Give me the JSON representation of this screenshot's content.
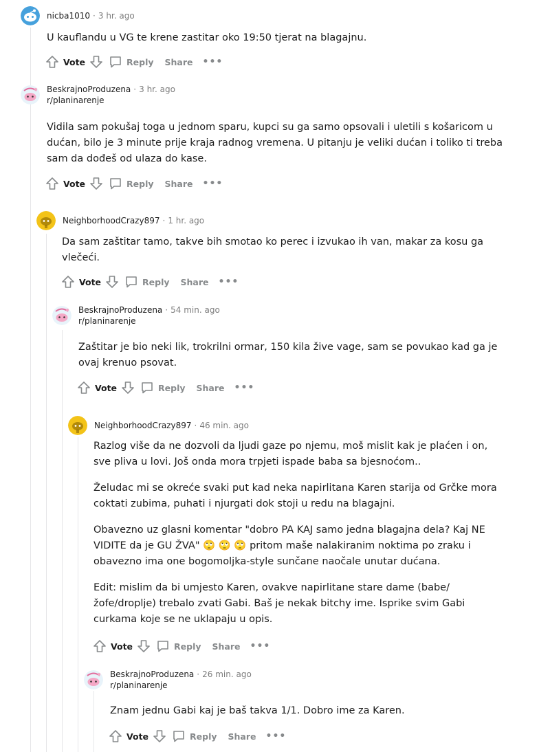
{
  "comments": [
    {
      "user": "nicba1010",
      "time": "3 hr. ago",
      "subreddit": "",
      "avatar": "snoo-blue-icon",
      "paragraphs": [
        "U kauflandu u VG te krene zastitar oko 19:50 tjerat na blagajnu."
      ]
    },
    {
      "user": "BeskrajnoProduzena",
      "time": "3 hr. ago",
      "subreddit": "r/planinarenje",
      "avatar": "snoo-pink-icon",
      "paragraphs": [
        "Vidila sam pokušaj toga u jednom sparu, kupci su ga samo opsovali i uletili s košaricom u dućan, bilo je 3 minute prije kraja radnog vremena. U pitanju je veliki dućan i toliko ti treba sam da dođeš od ulaza do kase."
      ]
    },
    {
      "user": "NeighborhoodCrazy897",
      "time": "1 hr. ago",
      "subreddit": "",
      "avatar": "snoo-yellow-icon",
      "paragraphs": [
        "Da sam zaštitar tamo, takve bih smotao ko perec i izvukao ih van, makar za kosu ga vlečeći."
      ]
    },
    {
      "user": "BeskrajnoProduzena",
      "time": "54 min. ago",
      "subreddit": "r/planinarenje",
      "avatar": "snoo-pink-icon",
      "paragraphs": [
        "Zaštitar je bio neki lik, trokrilni ormar, 150 kila žive vage, sam se povukao kad ga je ovaj krenuo psovat."
      ]
    },
    {
      "user": "NeighborhoodCrazy897",
      "time": "46 min. ago",
      "subreddit": "",
      "avatar": "snoo-yellow-icon",
      "paragraphs": [
        "Razlog više da ne dozvoli da ljudi gaze po njemu, moš mislit kak je plaćen i on, sve pliva u lovi. Još onda mora trpjeti ispade baba sa bjesnoćom..",
        "Želudac mi se okreće svaki put kad neka napirlitana Karen starija od Grčke mora coktati zubima, puhati i njurgati dok stoji u redu na blagajni.",
        "Obavezno uz glasni komentar \"dobro PA KAJ samo jedna blagajna dela? Kaj NE VIDITE da je GU ŽVA\" 🙄 🙄 🙄 pritom maše nalakiranim noktima po zraku i obavezno ima one bogomoljka-style sunčane naočale unutar dućana.",
        "Edit: mislim da bi umjesto Karen, ovakve napirlitane stare dame (babe/žofe/droplje) trebalo zvati Gabi. Baš je nekak bitchy ime. Isprike svim Gabi curkama koje se ne uklapaju u opis."
      ]
    },
    {
      "user": "BeskrajnoProduzena",
      "time": "26 min. ago",
      "subreddit": "r/planinarenje",
      "avatar": "snoo-pink-icon",
      "paragraphs": [
        "Znam jednu Gabi kaj je baš takva 1/1. Dobro ime za Karen."
      ]
    }
  ],
  "actions": {
    "vote": "Vote",
    "reply": "Reply",
    "share": "Share",
    "more": "•••"
  },
  "colors": {
    "text": "#1c1c1c",
    "meta": "#7c7c7c",
    "action": "#878a8c",
    "thread_line": "#e5e6e8",
    "snoo_blue": "#46a1dc",
    "snoo_yellow": "#f3c318",
    "snoo_pink": "#f4a8c6"
  }
}
